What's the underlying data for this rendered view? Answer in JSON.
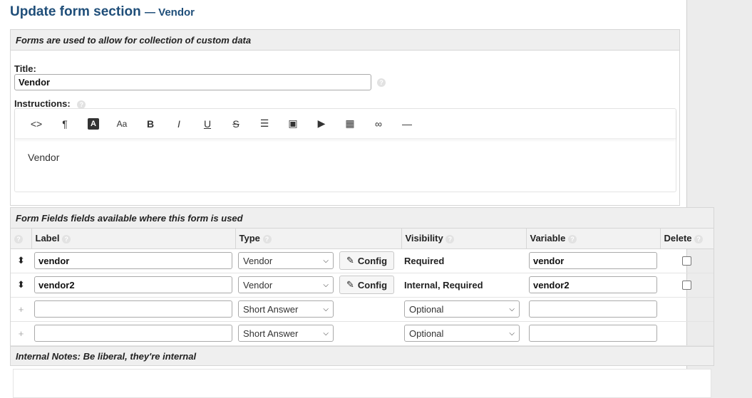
{
  "page": {
    "title": "Update form section",
    "subtitle": "— Vendor"
  },
  "form_panel": {
    "header": "Forms are used to allow for collection of custom data",
    "title_label": "Title:",
    "title_value": "Vendor",
    "instructions_label": "Instructions:",
    "editor_content": "Vendor",
    "toolbar": [
      {
        "icon": "code-view-icon",
        "glyph": "<>"
      },
      {
        "icon": "paragraph-icon",
        "glyph": "¶"
      },
      {
        "icon": "font-color-icon",
        "glyph": "A"
      },
      {
        "icon": "font-size-icon",
        "glyph": "Aa"
      },
      {
        "icon": "bold-icon",
        "glyph": "B"
      },
      {
        "icon": "italic-icon",
        "glyph": "I"
      },
      {
        "icon": "underline-icon",
        "glyph": "U"
      },
      {
        "icon": "strikethrough-icon",
        "glyph": "S"
      },
      {
        "icon": "list-icon",
        "glyph": "☰"
      },
      {
        "icon": "image-icon",
        "glyph": "▣"
      },
      {
        "icon": "video-icon",
        "glyph": "▶"
      },
      {
        "icon": "table-icon",
        "glyph": "▦"
      },
      {
        "icon": "link-icon",
        "glyph": "∞"
      },
      {
        "icon": "horizontal-rule-icon",
        "glyph": "—"
      }
    ]
  },
  "fields_panel": {
    "header": "Form Fields fields available where this form is used",
    "columns": {
      "label": "Label",
      "type": "Type",
      "visibility": "Visibility",
      "variable": "Variable",
      "delete": "Delete"
    },
    "config_label": "Config",
    "rows": [
      {
        "label": "vendor",
        "type": "Vendor",
        "visibility": "Required",
        "variable": "vendor"
      },
      {
        "label": "vendor2",
        "type": "Vendor",
        "visibility": "Internal, Required",
        "variable": "vendor2"
      }
    ],
    "new_rows": [
      {
        "type": "Short Answer",
        "visibility": "Optional"
      },
      {
        "type": "Short Answer",
        "visibility": "Optional"
      }
    ]
  },
  "notes": {
    "header": "Internal Notes: Be liberal, they're internal"
  }
}
